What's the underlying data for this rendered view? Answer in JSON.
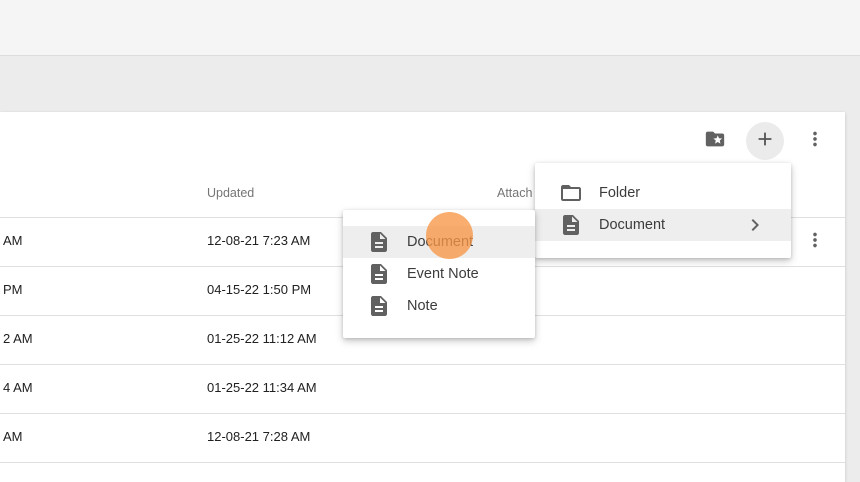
{
  "table": {
    "headers": {
      "updated": "Updated",
      "attachments": "Attach"
    },
    "rows": [
      {
        "created": "AM",
        "updated": "12-08-21 7:23 AM"
      },
      {
        "created": "PM",
        "updated": "04-15-22 1:50 PM"
      },
      {
        "created": "2 AM",
        "updated": "01-25-22 11:12 AM"
      },
      {
        "created": "4 AM",
        "updated": "01-25-22 11:34 AM"
      },
      {
        "created": "AM",
        "updated": "12-08-21 7:28 AM"
      }
    ]
  },
  "toolbar": {
    "icons": [
      "folder-star-icon",
      "plus-icon",
      "more-vertical-icon"
    ]
  },
  "add_menu": {
    "items": [
      {
        "label": "Folder",
        "icon": "folder-outline-icon"
      },
      {
        "label": "Document",
        "icon": "document-icon",
        "submenu": "chevron-right-icon"
      }
    ]
  },
  "document_submenu": {
    "items": [
      {
        "label": "Document",
        "icon": "document-icon"
      },
      {
        "label": "Event Note",
        "icon": "document-icon"
      },
      {
        "label": "Note",
        "icon": "document-icon"
      }
    ]
  },
  "colors": {
    "click_indicator": "#f79646",
    "icon": "#616161",
    "highlight": "#eeeeee"
  }
}
